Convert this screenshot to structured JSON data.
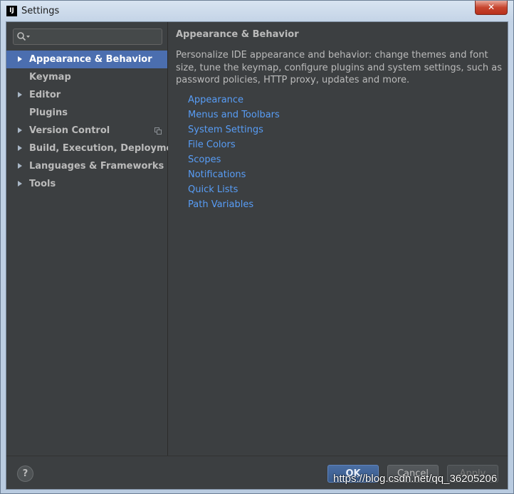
{
  "window": {
    "title": "Settings",
    "app_icon_text": "IJ",
    "close_symbol": "✕"
  },
  "search": {
    "value": "",
    "placeholder": ""
  },
  "sidebar": {
    "items": [
      {
        "label": "Appearance & Behavior",
        "expandable": true,
        "selected": true
      },
      {
        "label": "Keymap",
        "expandable": false,
        "selected": false
      },
      {
        "label": "Editor",
        "expandable": true,
        "selected": false
      },
      {
        "label": "Plugins",
        "expandable": false,
        "selected": false
      },
      {
        "label": "Version Control",
        "expandable": true,
        "selected": false,
        "icon": "copy-icon"
      },
      {
        "label": "Build, Execution, Deployment",
        "expandable": true,
        "selected": false
      },
      {
        "label": "Languages & Frameworks",
        "expandable": true,
        "selected": false
      },
      {
        "label": "Tools",
        "expandable": true,
        "selected": false
      }
    ]
  },
  "content": {
    "title": "Appearance & Behavior",
    "description": "Personalize IDE appearance and behavior: change themes and font size, tune the keymap, configure plugins and system settings, such as password policies, HTTP proxy, updates and more.",
    "links": [
      "Appearance",
      "Menus and Toolbars",
      "System Settings",
      "File Colors",
      "Scopes",
      "Notifications",
      "Quick Lists",
      "Path Variables"
    ]
  },
  "footer": {
    "help_label": "?",
    "ok_label": "OK",
    "cancel_label": "Cancel",
    "apply_label": "Apply"
  },
  "watermark": "https://blog.csdn.net/qq_36205206",
  "colors": {
    "background": "#3c3f41",
    "selection": "#4b6eaf",
    "link": "#589df6",
    "text": "#bbbbbb"
  }
}
